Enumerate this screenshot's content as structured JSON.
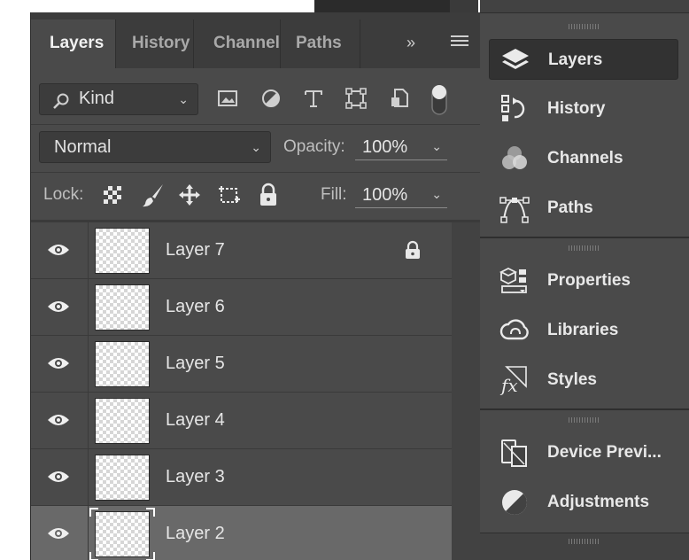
{
  "tabs": [
    {
      "label": "Layers",
      "active": true
    },
    {
      "label": "History",
      "active": false
    },
    {
      "label": "Channels",
      "active": false
    },
    {
      "label": "Paths",
      "active": false
    }
  ],
  "tab_overflow": "»",
  "filter": {
    "kind_label": "Kind"
  },
  "blend": {
    "mode": "Normal",
    "opacity_label": "Opacity:",
    "opacity_value": "100%"
  },
  "lock": {
    "label": "Lock:",
    "fill_label": "Fill:",
    "fill_value": "100%"
  },
  "layers": [
    {
      "name": "Layer 7",
      "locked": true,
      "selected": false
    },
    {
      "name": "Layer 6",
      "locked": false,
      "selected": false
    },
    {
      "name": "Layer 5",
      "locked": false,
      "selected": false
    },
    {
      "name": "Layer 4",
      "locked": false,
      "selected": false
    },
    {
      "name": "Layer 3",
      "locked": false,
      "selected": false
    },
    {
      "name": "Layer 2",
      "locked": false,
      "selected": true
    }
  ],
  "dock": {
    "group1": [
      {
        "label": "Layers",
        "icon": "layers-icon",
        "active": true
      },
      {
        "label": "History",
        "icon": "history-icon",
        "active": false
      },
      {
        "label": "Channels",
        "icon": "channels-icon",
        "active": false
      },
      {
        "label": "Paths",
        "icon": "paths-icon",
        "active": false
      }
    ],
    "group2": [
      {
        "label": "Properties",
        "icon": "properties-icon"
      },
      {
        "label": "Libraries",
        "icon": "libraries-icon"
      },
      {
        "label": "Styles",
        "icon": "styles-icon"
      }
    ],
    "group3": [
      {
        "label": "Device Previ...",
        "icon": "device-preview-icon"
      },
      {
        "label": "Adjustments",
        "icon": "adjustments-icon"
      }
    ]
  },
  "colors": {
    "panel": "#4a4a4a",
    "tabbar": "#3c3c3c",
    "selected_row": "#696969",
    "dock": "#424242"
  }
}
